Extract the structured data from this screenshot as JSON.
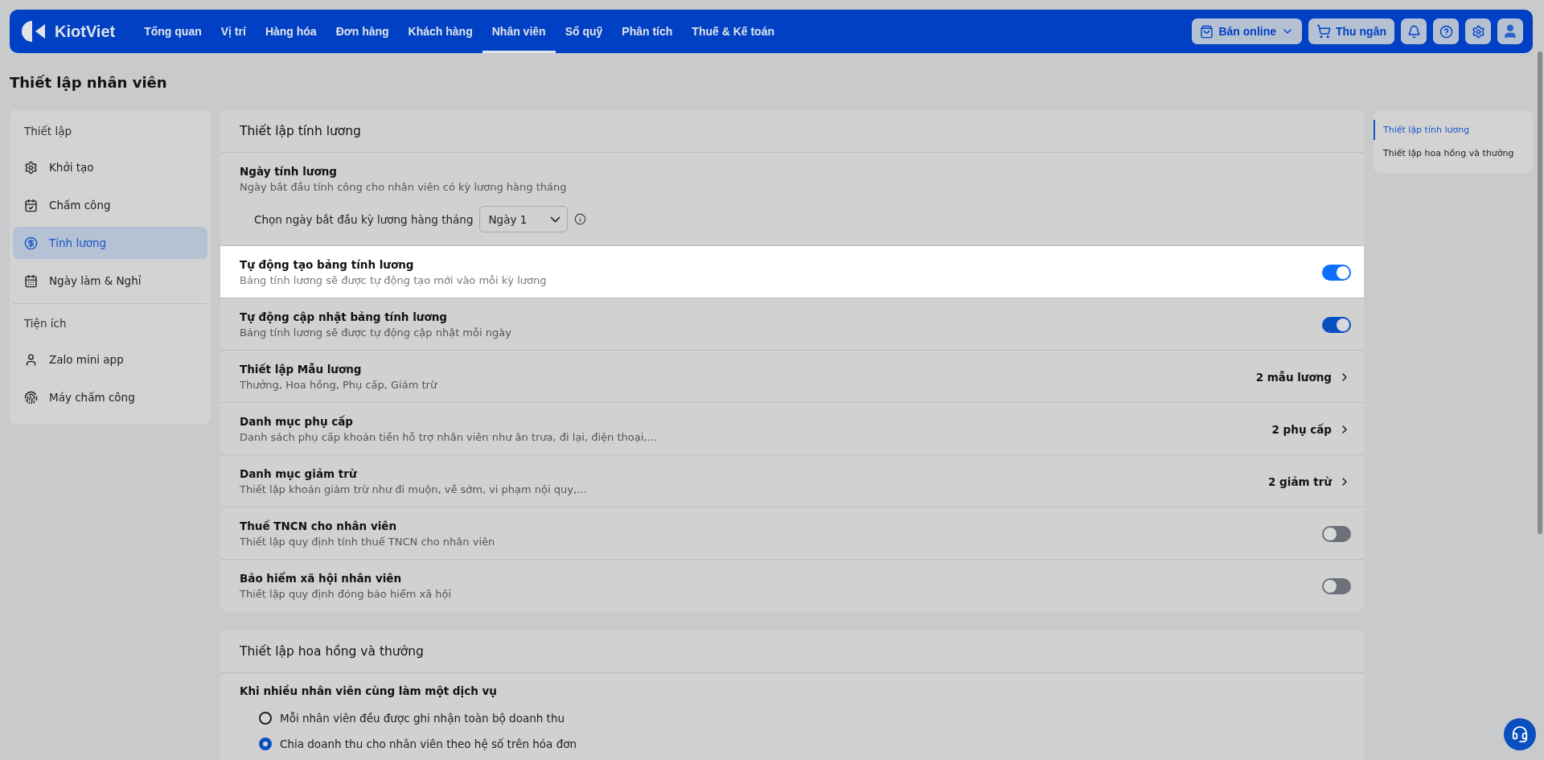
{
  "nav": {
    "logo": "KiotViet",
    "items": [
      {
        "label": "Tổng quan",
        "selected": false
      },
      {
        "label": "Vị trí",
        "selected": false
      },
      {
        "label": "Hàng hóa",
        "selected": false
      },
      {
        "label": "Đơn hàng",
        "selected": false
      },
      {
        "label": "Khách hàng",
        "selected": false
      },
      {
        "label": "Nhân viên",
        "selected": true
      },
      {
        "label": "Sổ quỹ",
        "selected": false
      },
      {
        "label": "Phân tích",
        "selected": false
      },
      {
        "label": "Thuế & Kế toán",
        "selected": false
      }
    ],
    "online_button": "Bán online",
    "cashier_button": "Thu ngân"
  },
  "page_title": "Thiết lập nhân viên",
  "sidebar": {
    "groups": [
      {
        "title": "Thiết lập",
        "items": [
          {
            "label": "Khởi tạo",
            "selected": false
          },
          {
            "label": "Chấm công",
            "selected": false
          },
          {
            "label": "Tính lương",
            "selected": true
          },
          {
            "label": "Ngày làm & Nghỉ",
            "selected": false
          }
        ]
      },
      {
        "title": "Tiện ích",
        "items": [
          {
            "label": "Zalo mini app",
            "selected": false
          },
          {
            "label": "Máy chấm công",
            "selected": false
          }
        ]
      }
    ]
  },
  "payroll": {
    "title": "Thiết lập tính lương",
    "rows": [
      {
        "kind": "select",
        "title": "Ngày tính lương",
        "description": "Ngày bắt đầu tính công cho nhân viên có kỳ lương hàng tháng",
        "select_label": "Chọn ngày bắt đầu kỳ lương hàng tháng",
        "value": "Ngày 1",
        "highlighted": false
      },
      {
        "kind": "toggle",
        "title": "Tự động tạo bảng tính lương",
        "description": "Bảng tính lương sẽ được tự động tạo mới vào mỗi kỳ lương",
        "on": true,
        "highlighted": true
      },
      {
        "kind": "toggle",
        "title": "Tự động cập nhật bảng tính lương",
        "description": "Bảng tính lương sẽ được tự động cập nhật mỗi ngày",
        "on": true,
        "highlighted": false
      },
      {
        "kind": "link",
        "title": "Thiết lập Mẫu lương",
        "description": "Thưởng, Hoa hồng, Phụ cấp, Giảm trừ",
        "link": "2 mẫu lương",
        "highlighted": false
      },
      {
        "kind": "link",
        "title": "Danh mục phụ cấp",
        "description": "Danh sách phụ cấp khoản tiền hỗ trợ nhân viên như ăn trưa, đi lại, điện thoại,...",
        "link": "2 phụ cấp",
        "highlighted": false
      },
      {
        "kind": "link",
        "title": "Danh mục giảm trừ",
        "description": "Thiết lập khoản giảm trừ như đi muộn, về sớm, vi phạm nội quy,...",
        "link": "2 giảm trừ",
        "highlighted": false
      },
      {
        "kind": "toggle",
        "title": "Thuế TNCN cho nhân viên",
        "description": "Thiết lập quy định tính thuế TNCN cho nhân viên",
        "on": false,
        "highlighted": false
      },
      {
        "kind": "toggle",
        "title": "Bảo hiểm xã hội nhân viên",
        "description": "Thiết lập quy định đóng bảo hiểm xã hội",
        "on": false,
        "highlighted": false
      }
    ]
  },
  "commission": {
    "title": "Thiết lập hoa hồng và thưởng",
    "question": "Khi nhiều nhân viên cùng làm một dịch vụ",
    "options": [
      {
        "label": "Mỗi nhân viên đều được ghi nhận toàn bộ doanh thu",
        "selected": false
      },
      {
        "label": "Chia doanh thu cho nhân viên theo hệ số trên hóa đơn",
        "selected": true
      }
    ]
  },
  "anchors": [
    {
      "label": "Thiết lập tính lương",
      "selected": true
    },
    {
      "label": "Thiết lập hoa hồng và thưởng",
      "selected": false
    }
  ]
}
